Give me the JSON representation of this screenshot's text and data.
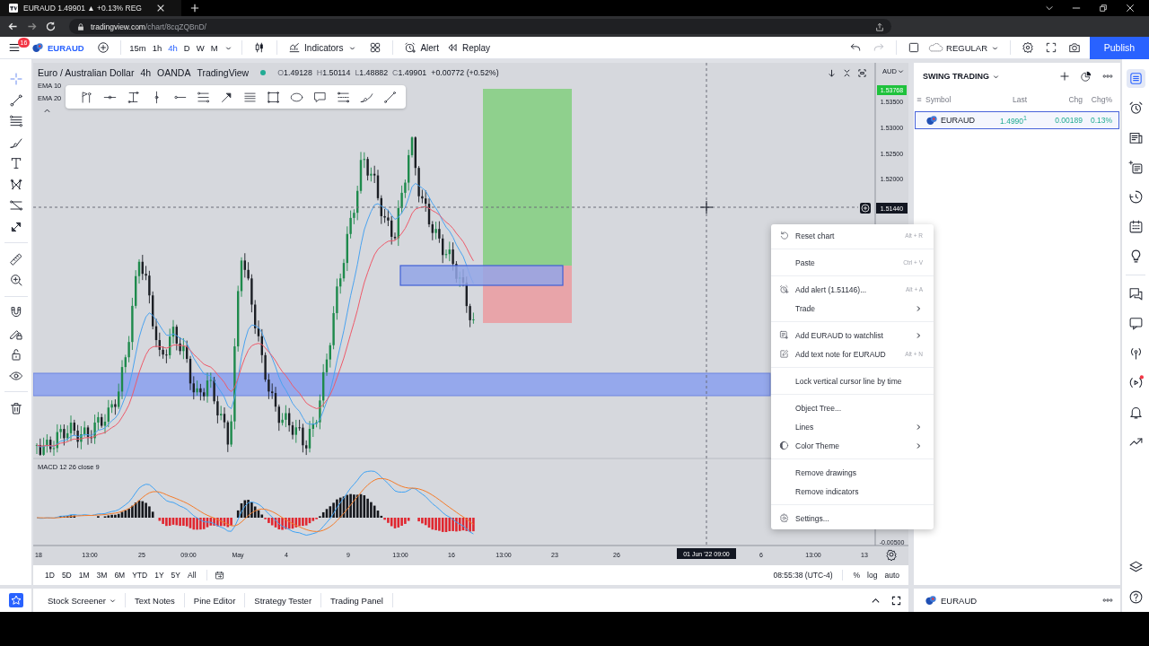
{
  "browser": {
    "tab_title": "EURAUD 1.49901 ▲ +0.13% REG",
    "url_host": "tradingview.com",
    "url_path": "/chart/8cqZQBnD/"
  },
  "header": {
    "menu_badge": "16",
    "symbol": "EURAUD",
    "intervals": [
      {
        "label": "15m",
        "selected": false
      },
      {
        "label": "1h",
        "selected": false
      },
      {
        "label": "4h",
        "selected": true
      },
      {
        "label": "D",
        "selected": false
      },
      {
        "label": "W",
        "selected": false
      },
      {
        "label": "M",
        "selected": false
      }
    ],
    "indicators": "Indicators",
    "alert": "Alert",
    "replay": "Replay",
    "session": "REGULAR",
    "publish": "Publish"
  },
  "left_toolbar": {
    "groups": [
      [
        {
          "kind": "crosshair",
          "selected": true
        },
        {
          "kind": "trend",
          "selected": false
        },
        {
          "kind": "fib",
          "selected": false
        },
        {
          "kind": "brush",
          "selected": false
        },
        {
          "kind": "text",
          "selected": false
        },
        {
          "kind": "pattern",
          "selected": false
        },
        {
          "kind": "projection",
          "selected": false
        },
        {
          "kind": "arrow",
          "selected": false
        }
      ],
      [
        {
          "kind": "ruler",
          "selected": false
        },
        {
          "kind": "zoom",
          "selected": false
        }
      ],
      [
        {
          "kind": "magnet",
          "selected": false
        },
        {
          "kind": "drawlock",
          "selected": false
        },
        {
          "kind": "lock",
          "selected": false
        },
        {
          "kind": "eye",
          "selected": false
        }
      ],
      [
        {
          "kind": "trash",
          "selected": false
        }
      ]
    ]
  },
  "chart": {
    "legend": {
      "title": "Euro / Australian Dollar",
      "interval": "4h",
      "exchange": "OANDA",
      "source": "TradingView",
      "market_open": true,
      "ohlc": [
        {
          "label": "O",
          "value": "1.49128"
        },
        {
          "label": "H",
          "value": "1.50114"
        },
        {
          "label": "L",
          "value": "1.48882"
        },
        {
          "label": "C",
          "value": "1.49901"
        }
      ],
      "change": "+0.00772 (+0.52%)"
    },
    "studies": [
      "EMA 10",
      "EMA 20"
    ],
    "currency": "AUD",
    "last_price": "1.53768",
    "price_ticks": [
      "1.53500",
      "1.53000",
      "1.52500",
      "1.52000"
    ],
    "crosshair_price": "1.51440",
    "macd_title": "MACD 12 26 close 9",
    "macd_tick": "-0.00500",
    "time_ticks": [
      "18",
      "13:00",
      "25",
      "09:00",
      "May",
      "4",
      "9",
      "13:00",
      "16",
      "13:00",
      "23",
      "26",
      "6",
      "13:00",
      "13"
    ],
    "crosshair_time": "01 Jun '22 09:00"
  },
  "context_menu": {
    "groups": [
      [
        {
          "label": "Reset chart",
          "shortcut": "Alt + R",
          "kind": "reset",
          "submenu": false
        }
      ],
      [
        {
          "label": "Paste",
          "shortcut": "Ctrl + V",
          "kind": "plain",
          "submenu": false
        }
      ],
      [
        {
          "label": "Add alert (1.51146)...",
          "shortcut": "Alt + A",
          "kind": "alert",
          "submenu": false
        },
        {
          "label": "Trade",
          "kind": "plain",
          "submenu": true
        }
      ],
      [
        {
          "label": "Add EURAUD to watchlist",
          "kind": "watchlist",
          "submenu": true
        },
        {
          "label": "Add text note for EURAUD",
          "shortcut": "Alt + N",
          "kind": "note",
          "submenu": false
        }
      ],
      [
        {
          "label": "Lock vertical cursor line by time",
          "kind": "plain",
          "submenu": false
        }
      ],
      [
        {
          "label": "Object Tree...",
          "kind": "plain",
          "submenu": false
        },
        {
          "label": "Lines",
          "kind": "plain",
          "submenu": true
        },
        {
          "label": "Color Theme",
          "kind": "theme",
          "submenu": true
        }
      ],
      [
        {
          "label": "Remove drawings",
          "kind": "plain",
          "submenu": false
        },
        {
          "label": "Remove indicators",
          "kind": "plain",
          "submenu": false
        }
      ],
      [
        {
          "label": "Settings...",
          "kind": "settings",
          "submenu": false
        }
      ]
    ]
  },
  "range_bar": {
    "ranges": [
      "1D",
      "5D",
      "1M",
      "3M",
      "6M",
      "YTD",
      "1Y",
      "5Y",
      "All"
    ],
    "clock": "08:55:38 (UTC-4)",
    "percent": "%",
    "log": "log",
    "auto": "auto"
  },
  "bottom_tabs": [
    {
      "label": "Stock Screener",
      "dropdown": true
    },
    {
      "label": "Text Notes",
      "dropdown": false
    },
    {
      "label": "Pine Editor",
      "dropdown": false
    },
    {
      "label": "Strategy Tester",
      "dropdown": false
    },
    {
      "label": "Trading Panel",
      "dropdown": false
    }
  ],
  "watchlist": {
    "title": "SWING TRADING",
    "columns": [
      "Symbol",
      "Last",
      "Chg",
      "Chg%"
    ],
    "rows": [
      {
        "symbol": "EURAUD",
        "last": "1.4990$^{1}$",
        "change": "0.00189",
        "change_percent": "0.13%",
        "selected": true
      }
    ]
  },
  "details": {
    "symbol": "EURAUD"
  },
  "right_sidebar": {
    "groups": [
      [
        {
          "kind": "watchlist",
          "selected": true,
          "notified": false
        },
        {
          "kind": "alarm",
          "selected": false,
          "notified": false
        },
        {
          "kind": "news",
          "selected": false,
          "notified": false
        },
        {
          "kind": "screener",
          "selected": false,
          "notified": false
        },
        {
          "kind": "history",
          "selected": false,
          "notified": false
        },
        {
          "kind": "calendar",
          "selected": false,
          "notified": false
        },
        {
          "kind": "bulb",
          "selected": false,
          "notified": false
        }
      ],
      [
        {
          "kind": "chats",
          "selected": false,
          "notified": false
        },
        {
          "kind": "chat",
          "selected": false,
          "notified": false
        },
        {
          "kind": "broadcast",
          "selected": false,
          "notified": false
        },
        {
          "kind": "stream",
          "selected": false,
          "notified": true
        },
        {
          "kind": "bell",
          "selected": false,
          "notified": false
        },
        {
          "kind": "pulse",
          "selected": false,
          "notified": false
        }
      ],
      [
        {
          "kind": "layers",
          "selected": false,
          "notified": false
        },
        {
          "kind": "help",
          "selected": false,
          "notified": false
        }
      ]
    ]
  }
}
